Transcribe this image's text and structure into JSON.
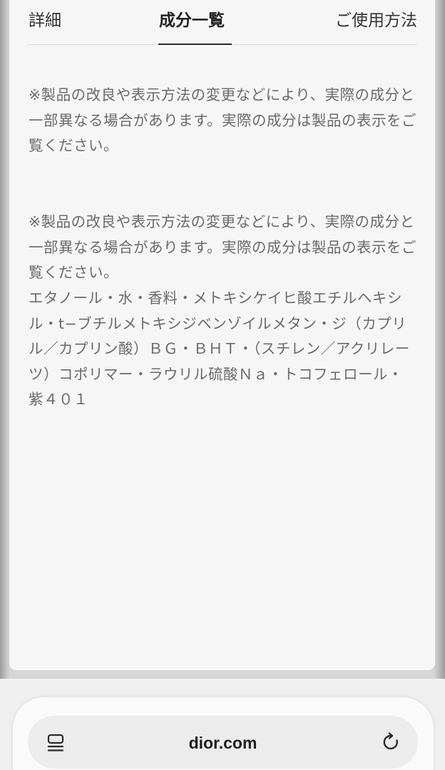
{
  "tabs": {
    "details": "詳細",
    "ingredients": "成分一覧",
    "usage": "ご使用方法",
    "active": "ingredients"
  },
  "content": {
    "notice_1": "※製品の改良や表示方法の変更などにより、実際の成分と一部異なる場合があります。実際の成分は製品の表示をご覧ください。",
    "notice_2": "※製品の改良や表示方法の変更などにより、実際の成分と一部異なる場合があります。実際の成分は製品の表示をご覧ください。",
    "ingredients_list": "エタノール・水・香料・メトキシケイヒ酸エチルヘキシル・t−ブチルメトキシジベンゾイルメタン・ジ（カプリル／カプリン酸）ＢＧ・ＢＨＴ・（スチレン／アクリレーツ）コポリマー・ラウリル硫酸Ｎａ・トコフェロール・紫４０１"
  },
  "browser": {
    "domain": "dior.com",
    "menu_icon": "page-menu-icon",
    "reload_icon": "reload-icon"
  }
}
